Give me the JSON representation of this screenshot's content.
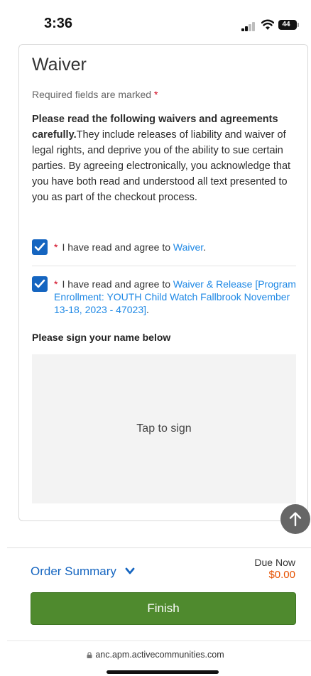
{
  "status": {
    "time": "3:36",
    "battery": "44"
  },
  "form": {
    "title": "Waiver",
    "required_note": "Required fields are marked",
    "required_marker": "*",
    "intro_bold": "Please read the following waivers and agreements carefully.",
    "intro_text": "They include releases of liability and waiver of legal rights, and deprive you of the ability to sue certain parties. By agreeing electronically, you acknowledge that you have both read and understood all text presented to you as part of the checkout process.",
    "agreements": [
      {
        "checked": true,
        "prefix": "I have read and agree to ",
        "link": "Waiver",
        "suffix": "."
      },
      {
        "checked": true,
        "prefix": "I have read and agree to ",
        "link": "Waiver & Release [Program Enrollment: YOUTH Child Watch Fallbrook November 13-18, 2023 - 47023]",
        "suffix": "."
      }
    ],
    "sign_label": "Please sign your name below",
    "sign_hint": "Tap to sign"
  },
  "footer": {
    "order_summary": "Order Summary",
    "due_label": "Due Now",
    "due_amount": "$0.00",
    "finish": "Finish"
  },
  "browser": {
    "url": "anc.apm.activecommunities.com"
  },
  "colors": {
    "accent": "#1565c0",
    "link": "#1e88e5",
    "finish": "#4f8a2e",
    "due": "#e65100",
    "required": "#d0021b"
  }
}
